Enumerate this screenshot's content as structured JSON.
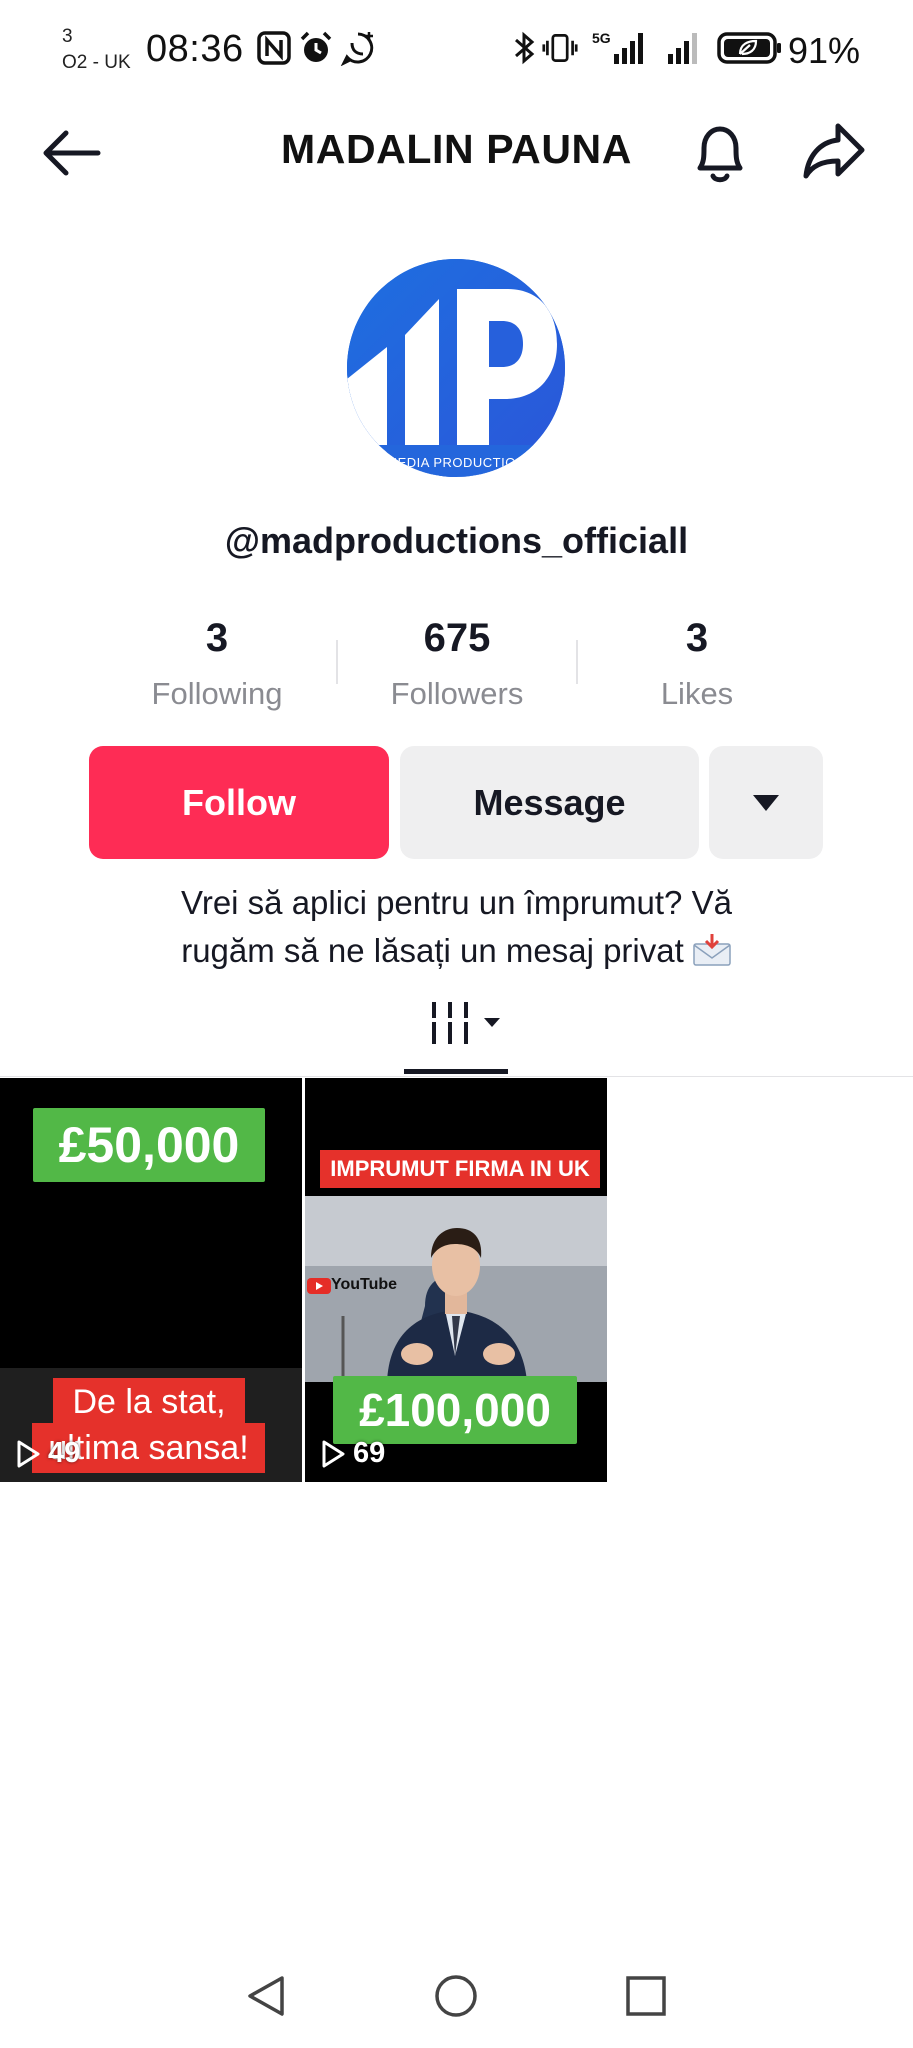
{
  "status_bar": {
    "carrier_slot": "3",
    "carrier": "O2 - UK",
    "time": "08:36",
    "network": "5G",
    "battery": "91%"
  },
  "header": {
    "title": "MADALIN PAUNA"
  },
  "profile": {
    "avatar_caption": "MEDIA PRODUCTION",
    "handle": "@madproductions_officiall",
    "stats": [
      {
        "value": "3",
        "label": "Following"
      },
      {
        "value": "675",
        "label": "Followers"
      },
      {
        "value": "3",
        "label": "Likes"
      }
    ],
    "buttons": {
      "follow": "Follow",
      "message": "Message"
    },
    "bio_line1": "Vrei să aplici pentru un împrumut? Vă",
    "bio_line2": "rugăm să ne lăsați un mesaj privat"
  },
  "videos": [
    {
      "top_tag": "£50,000",
      "caption_line1": "De la stat,",
      "caption_line2": "ultima sansa!",
      "views": "49"
    },
    {
      "top_banner": "IMPRUMUT FIRMA IN UK",
      "logo_text": "YouTube",
      "bottom_tag": "£100,000",
      "views": "69"
    }
  ],
  "colors": {
    "follow": "#fe2c55",
    "secondary_button": "#efeff0",
    "muted_text": "#8a8b91",
    "brand_blue": "#1565d8",
    "tag_green": "#52b847",
    "tag_red": "#e5312b"
  }
}
